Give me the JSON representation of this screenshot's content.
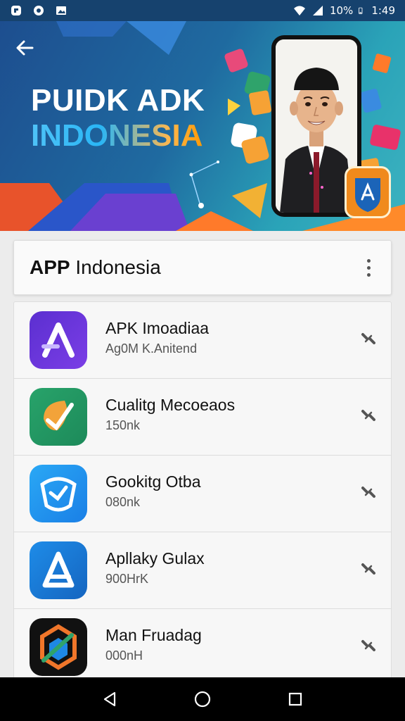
{
  "status_bar": {
    "battery_text": "10%",
    "time": "1:49"
  },
  "banner": {
    "title_line1": "PUIDK ADK",
    "title_line2": "INDONESIA"
  },
  "header": {
    "title_bold": "APP",
    "title_rest": " Indonesia"
  },
  "apps": [
    {
      "name": "APK Imoadiaa",
      "subtitle": "Ag0M K.Anitend",
      "icon": "stylized-a-icon",
      "color": "#6a35d9"
    },
    {
      "name": "Cualitg Mecoeaos",
      "subtitle": "150nk",
      "icon": "green-leaf-check-icon",
      "color": "#2fa36b"
    },
    {
      "name": "Gookitg Otba",
      "subtitle": "080nk",
      "icon": "blue-speed-shield-icon",
      "color": "#2196f3"
    },
    {
      "name": "Apllaky Gulax",
      "subtitle": "900HrK",
      "icon": "blue-a-arrow-icon",
      "color": "#1e88e5"
    },
    {
      "name": "Man Fruadag",
      "subtitle": "000nH",
      "icon": "dark-hexagon-icon",
      "color": "#111111"
    }
  ],
  "icons": {
    "back": "arrow-left-icon",
    "more": "more-vertical-icon",
    "action": "link-icon",
    "nav_back": "triangle-back-icon",
    "nav_home": "circle-home-icon",
    "nav_recents": "square-recents-icon"
  }
}
